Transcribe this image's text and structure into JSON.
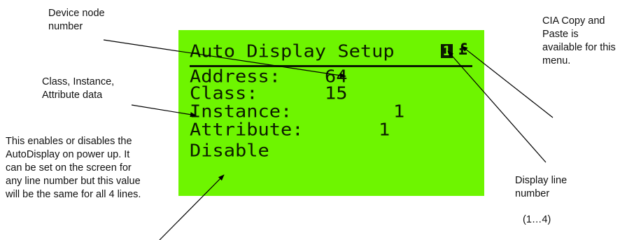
{
  "lcd": {
    "title": "Auto Display Setup",
    "line_number": "1",
    "cia_glyph": "£",
    "rows": [
      {
        "label": "Address:",
        "value": "64"
      },
      {
        "label": "Class:",
        "value": "15"
      },
      {
        "label": "Instance:",
        "value": "1"
      },
      {
        "label": "Attribute:",
        "value": "1"
      }
    ],
    "state": "Disable"
  },
  "callouts": {
    "node": "Device node\nnumber",
    "class": "Class, Instance,\nAttribute data",
    "enable": "This enables or disables the\nAutoDisplay on power up. It\ncan be set on the screen for\nany line number but this value\nwill be the same for all 4 lines.",
    "cia": "CIA Copy and\nPaste is\navailable for this\nmenu.",
    "line": "Display line\nnumber",
    "line_range": "(1…4)"
  },
  "colors": {
    "lcd_background": "#6ef500",
    "lcd_text": "#0c1a00"
  }
}
